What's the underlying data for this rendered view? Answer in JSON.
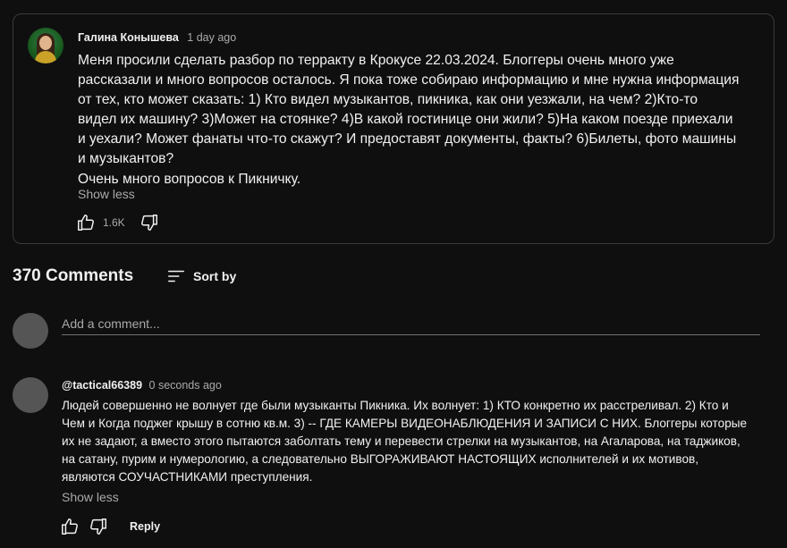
{
  "pinned": {
    "author": "Галина Конышева",
    "time": "1 day ago",
    "lines": [
      "Меня просили сделать разбор по терракту в Крокусе 22.03.2024. Блоггеры очень много уже рассказали и много вопросов осталось. Я пока тоже собираю информацию и мне нужна информация от тех, кто может сказать: 1) Кто видел музыкантов, пикника, как они уезжали, на чем? 2)Кто-то видел их машину? 3)Может на стоянке? 4)В какой гостинице они жили? 5)На каком поезде приехали и уехали? Может фанаты что-то скажут? И предоставят документы, факты? 6)Билеты, фото машины и музыкантов?",
      "Очень много вопросов к Пикничку."
    ],
    "show_less": "Show less",
    "like_count": "1.6K"
  },
  "comments": {
    "count_label": "370 Comments",
    "sort_label": "Sort by"
  },
  "add_comment": {
    "placeholder": "Add a comment..."
  },
  "reply": {
    "author": "@tactical66389",
    "time": "0 seconds ago",
    "text": "Людей совершенно не волнует где были музыканты Пикника. Их волнует: 1) КТО конкретно их расстреливал. 2) Кто и Чем и Когда поджег крышу в сотню кв.м. 3) -- ГДЕ КАМЕРЫ ВИДЕОНАБЛЮДЕНИЯ И ЗАПИСИ С НИХ. Блоггеры которые их не задают, а вместо этого пытаются заболтать тему и перевести стрелки на музыкантов, на Агаларова, на таджиков, на сатану, пурим и нумерологию, а следовательно ВЫГОРАЖИВАЮТ НАСТОЯЩИХ исполнителей и их мотивов, являются СОУЧАСТНИКАМИ преступления.",
    "show_less": "Show less",
    "reply_label": "Reply"
  },
  "colors": {
    "background": "#0f0f0f",
    "text_primary": "#f1f1f1",
    "text_secondary": "#aaaaaa",
    "border": "#3a3a3a"
  },
  "icons": [
    "thumbs-up-icon",
    "thumbs-down-icon",
    "sort-icon"
  ]
}
